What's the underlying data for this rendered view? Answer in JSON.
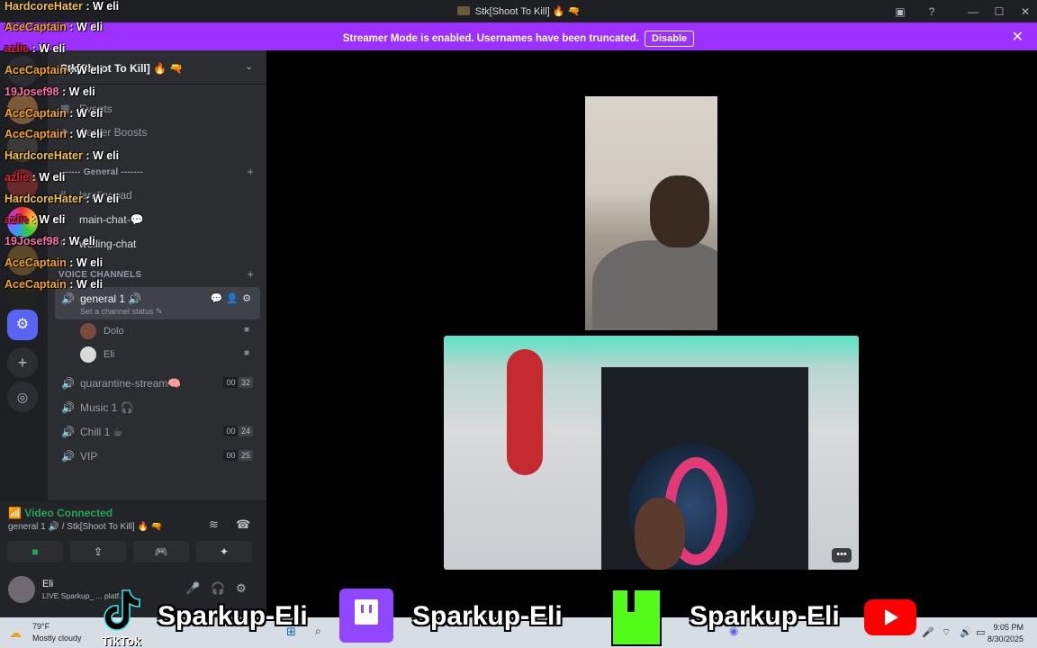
{
  "window": {
    "title": "Stk[Shoot To Kill] 🔥 🔫",
    "controls": [
      "minimize",
      "maximize",
      "close"
    ]
  },
  "banner": {
    "message": "Streamer Mode is enabled. Usernames have been truncated.",
    "disable_label": "Disable",
    "close": "✕"
  },
  "server": {
    "name": "Stk[Shoot To Kill] 🔥 🔫",
    "items": [
      {
        "label": "Events",
        "icon": "calendar-icon"
      },
      {
        "label": "Server Boosts",
        "icon": "boost-icon"
      }
    ],
    "category_general": "------- General -------",
    "text_channels": [
      {
        "label": "landingpad",
        "icon": "#"
      },
      {
        "label": "main-chat-💬",
        "icon": "#"
      },
      {
        "label": "welling-chat",
        "icon": "#"
      }
    ],
    "category_voice": "VOICE CHANNELS",
    "active_voice": {
      "label": "general 1 🔊",
      "status": "Set a channel status ✎"
    },
    "members": [
      {
        "name": "Dolo",
        "color": "#7a4a3a"
      },
      {
        "name": "Eli",
        "color": "#d9d9d9"
      }
    ],
    "voice_channels": [
      {
        "label": "quarantine-stream🧠",
        "c1": "00",
        "c2": "32"
      },
      {
        "label": "Music 1 🎧",
        "c1": "",
        "c2": ""
      },
      {
        "label": "Chill 1 ☕",
        "c1": "00",
        "c2": "24"
      },
      {
        "label": "VIP",
        "c1": "00",
        "c2": "25"
      }
    ]
  },
  "voice_panel": {
    "status": "Video Connected",
    "channel": "general 1 🔊 / Stk[Shoot To Kill] 🔥 🔫",
    "buttons": [
      "camera-icon",
      "screenshare-icon",
      "activity-icon",
      "soundboard-icon"
    ]
  },
  "user": {
    "name": "Eli",
    "activity": "LIVE Sparkup_ ... platf..."
  },
  "chat": [
    {
      "user": "HardcoreHater",
      "msg": " : W eli",
      "color": "#f5c242"
    },
    {
      "user": "AceCaptain",
      "msg": " : W eli",
      "color": "#f5a623"
    },
    {
      "user": "azlie",
      "msg": " : W eli",
      "color": "#e0213b"
    },
    {
      "user": "AceCaptain",
      "msg": " : W eli",
      "color": "#f5a623"
    },
    {
      "user": "19Josef98",
      "msg": " : W eli",
      "color": "#ff6fa8"
    },
    {
      "user": "AceCaptain",
      "msg": " : W eli",
      "color": "#f5a623"
    },
    {
      "user": "AceCaptain",
      "msg": " : W eli",
      "color": "#f5a623"
    },
    {
      "user": "HardcoreHater",
      "msg": " : W eli",
      "color": "#f5c242"
    },
    {
      "user": "azlie",
      "msg": " : W eli",
      "color": "#e0213b"
    },
    {
      "user": "HardcoreHater",
      "msg": " : W eli",
      "color": "#f5c242"
    },
    {
      "user": "azlie",
      "msg": " : W eli",
      "color": "#e0213b"
    },
    {
      "user": "19Josef98",
      "msg": " : W eli",
      "color": "#ff6fa8"
    },
    {
      "user": "AceCaptain",
      "msg": " : W eli",
      "color": "#f5a623"
    },
    {
      "user": "AceCaptain",
      "msg": " : W eli",
      "color": "#f5a623"
    }
  ],
  "social": {
    "handle_1": "Sparkup-Eli",
    "handle_2": "Sparkup-Eli",
    "handle_3": "Sparkup-Eli",
    "tiktok_label": "TikTok"
  },
  "taskbar": {
    "temp": "79°F",
    "weather": "Mostly cloudy",
    "time": "9:05 PM",
    "date": "8/30/2025"
  },
  "colors": {
    "banner": "#9b30ff",
    "connected": "#23a55a",
    "twitch": "#9146ff",
    "kick": "#53fc18",
    "youtube": "#ff0000"
  }
}
